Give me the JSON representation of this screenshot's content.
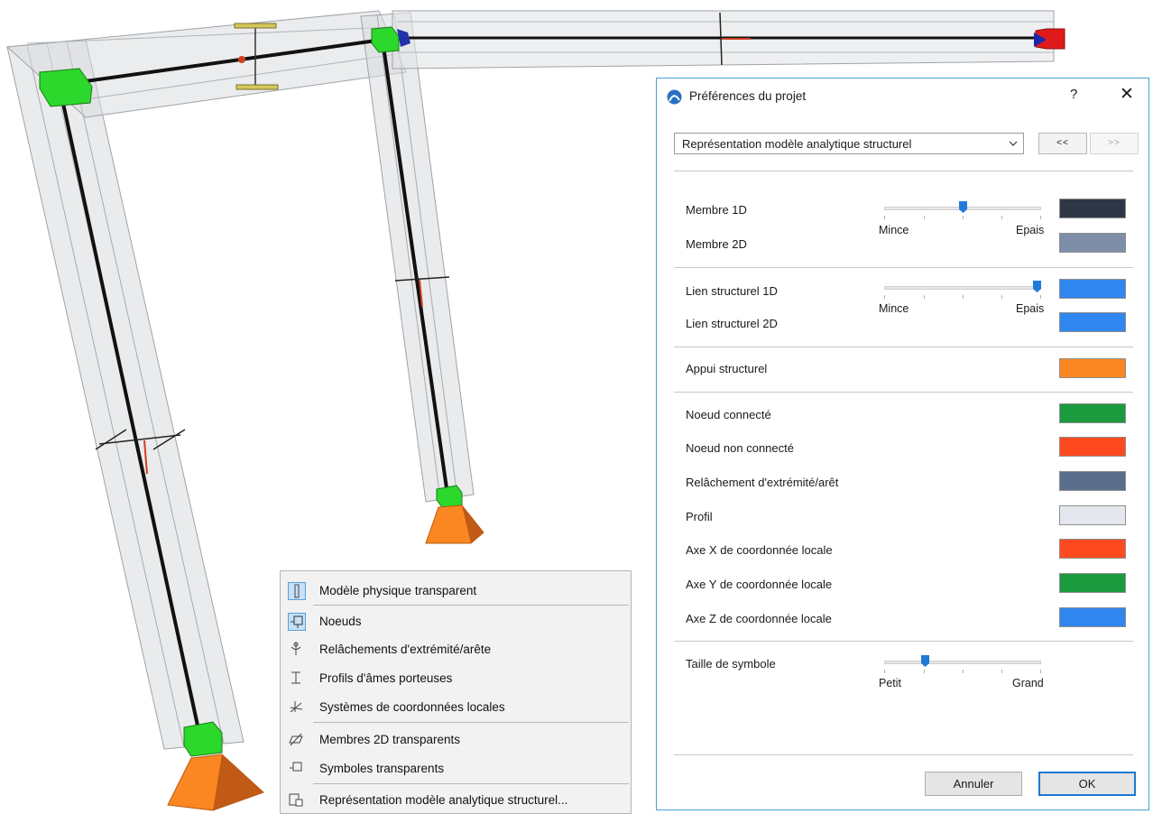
{
  "dialog": {
    "title": "Préférences du projet",
    "help": "?",
    "close": "✕",
    "dropdown_value": "Représentation modèle analytique structurel",
    "prev": "<<",
    "next": ">>",
    "member_1d": "Membre 1D",
    "member_2d": "Membre 2D",
    "member_slider": {
      "min": "Mince",
      "max": "Epais",
      "value": 0.5
    },
    "member_1d_color": "#2e3645",
    "member_2d_color": "#7e8ea8",
    "link_1d": "Lien structurel 1D",
    "link_2d": "Lien structurel 2D",
    "link_slider": {
      "min": "Mince",
      "max": "Epais",
      "value": 1.0
    },
    "link_1d_color": "#2f86ee",
    "link_2d_color": "#2f86ee",
    "support": "Appui structurel",
    "support_color": "#fb8722",
    "colors": [
      {
        "label": "Noeud connecté",
        "color": "#1c9a3e"
      },
      {
        "label": "Noeud non connecté",
        "color": "#ff4a1f"
      },
      {
        "label": "Relâchement d'extrémité/arêt",
        "color": "#5b6e8c"
      },
      {
        "label": "Profil",
        "color": "#e4e8ee"
      },
      {
        "label": "Axe X de coordonnée locale",
        "color": "#ff4a1f"
      },
      {
        "label": "Axe Y de coordonnée locale",
        "color": "#1c9a3e"
      },
      {
        "label": "Axe Z de coordonnée locale",
        "color": "#2f86ee"
      }
    ],
    "symbol_size": "Taille de symbole",
    "symbol_slider": {
      "min": "Petit",
      "max": "Grand",
      "value": 0.25
    },
    "cancel": "Annuler",
    "ok": "OK"
  },
  "menu": {
    "items": [
      {
        "label": "Modèle physique transparent",
        "icon": "transparent-model-icon",
        "checked": true
      },
      {
        "label": "Noeuds",
        "icon": "nodes-icon",
        "checked": true
      },
      {
        "label": "Relâchements d'extrémité/arête",
        "icon": "release-icon",
        "checked": false
      },
      {
        "label": "Profils d'âmes porteuses",
        "icon": "profile-icon",
        "checked": false
      },
      {
        "label": "Systèmes de coordonnées locales",
        "icon": "coordinate-system-icon",
        "checked": false
      },
      {
        "label": "Membres 2D transparents",
        "icon": "membrane-icon",
        "checked": false
      },
      {
        "label": "Symboles transparents",
        "icon": "symbol-icon",
        "checked": false
      },
      {
        "label": "Représentation modèle analytique structurel...",
        "icon": "representation-icon",
        "checked": false
      }
    ]
  }
}
